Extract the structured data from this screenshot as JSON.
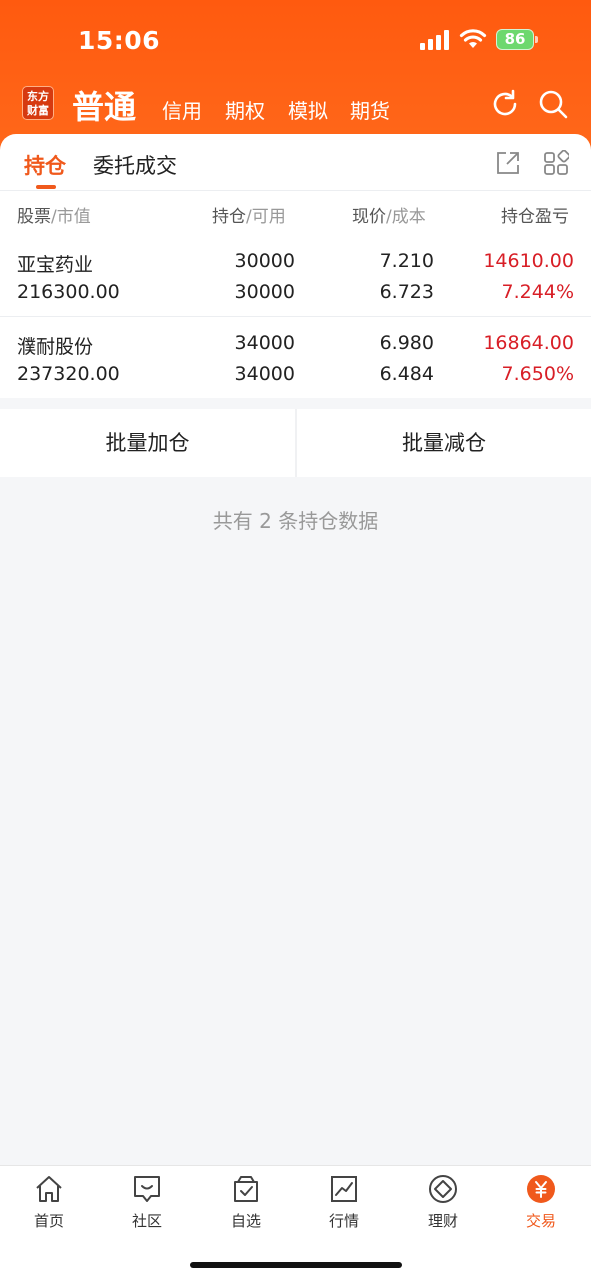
{
  "status_bar": {
    "time": "15:06",
    "battery": "86"
  },
  "header": {
    "logo_line1": "东方",
    "logo_line2": "财富",
    "tabs": [
      {
        "label": "普通",
        "active": true
      },
      {
        "label": "信用"
      },
      {
        "label": "期权"
      },
      {
        "label": "模拟"
      },
      {
        "label": "期货"
      }
    ],
    "icons": [
      "refresh-icon",
      "search-icon"
    ]
  },
  "subtabs": {
    "holdings": "持仓",
    "orders": "委托成交",
    "icons": [
      "share-icon",
      "grid-icon"
    ]
  },
  "table": {
    "headers": {
      "stock": "股票",
      "market_value": "市值",
      "position": "持仓",
      "available": "可用",
      "price": "现价",
      "cost": "成本",
      "pnl": "持仓盈亏"
    },
    "rows": [
      {
        "name": "亚宝药业",
        "market_value": "216300.00",
        "position": "30000",
        "available": "30000",
        "price": "7.210",
        "cost": "6.723",
        "pnl": "14610.00",
        "pnl_pct": "7.244%"
      },
      {
        "name": "濮耐股份",
        "market_value": "237320.00",
        "position": "34000",
        "available": "34000",
        "price": "6.980",
        "cost": "6.484",
        "pnl": "16864.00",
        "pnl_pct": "7.650%"
      }
    ]
  },
  "actions": {
    "batch_add": "批量加仓",
    "batch_reduce": "批量减仓"
  },
  "summary": "共有 2 条持仓数据",
  "tabbar": [
    {
      "label": "首页",
      "icon": "home-icon"
    },
    {
      "label": "社区",
      "icon": "chat-icon"
    },
    {
      "label": "自选",
      "icon": "watchlist-icon"
    },
    {
      "label": "行情",
      "icon": "market-chart-icon"
    },
    {
      "label": "理财",
      "icon": "finance-icon"
    },
    {
      "label": "交易",
      "icon": "trade-yuan-icon",
      "active": true
    }
  ],
  "colors": {
    "accent": "#ff5a0f",
    "active_text": "#f0591c",
    "profit": "#d81e26"
  }
}
